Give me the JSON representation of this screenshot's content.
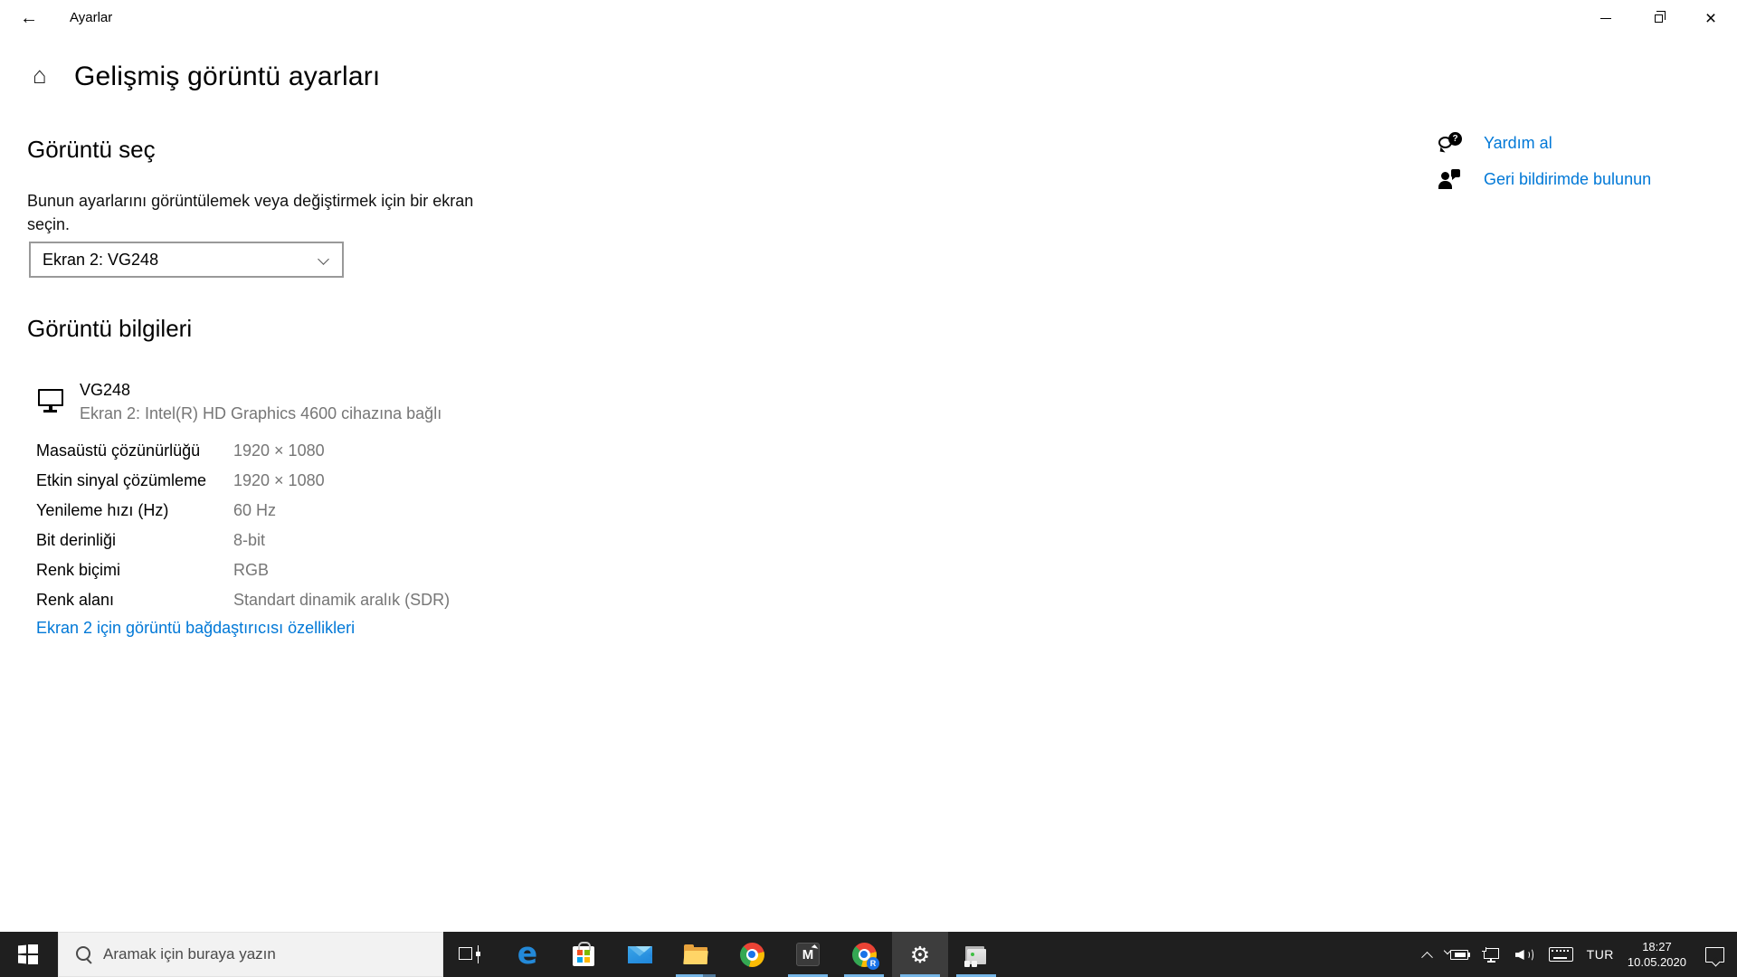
{
  "colors": {
    "accent_blue": "#0078d7",
    "link_blue": "#0078d7",
    "value_gray": "#767676",
    "taskbar_bg": "#1f1f1f",
    "running_underline": "#75b5e5"
  },
  "icons": {
    "back": "←",
    "home": "⌂",
    "close": "×",
    "gear": "⚙",
    "question": "?"
  },
  "titlebar": {
    "app_title": "Ayarlar"
  },
  "page": {
    "title": "Gelişmiş görüntü ayarları"
  },
  "display_select": {
    "heading": "Görüntü seç",
    "description": "Bunun ayarlarını görüntülemek veya değiştirmek için bir ekran seçin.",
    "selected_display": "Ekran 2: VG248"
  },
  "display_info": {
    "heading": "Görüntü bilgileri",
    "monitor_name": "VG248",
    "monitor_connection": "Ekran 2: Intel(R) HD Graphics 4600 cihazına bağlı",
    "properties": [
      {
        "label": "Masaüstü çözünürlüğü",
        "value": "1920 × 1080"
      },
      {
        "label": "Etkin sinyal çözümleme",
        "value": "1920 × 1080"
      },
      {
        "label": "Yenileme hızı (Hz)",
        "value": "60 Hz"
      },
      {
        "label": "Bit derinliği",
        "value": "8-bit"
      },
      {
        "label": "Renk biçimi",
        "value": "RGB"
      },
      {
        "label": "Renk alanı",
        "value": "Standart dinamik aralık (SDR)"
      }
    ],
    "adapter_link": "Ekran 2 için görüntü bağdaştırıcısı özellikleri"
  },
  "help_panel": {
    "get_help": "Yardım al",
    "feedback": "Geri bildirimde bulunun"
  },
  "taskbar": {
    "search_placeholder": "Aramak için buraya yazın",
    "m_app_label": "M",
    "chrome_profile_badge": "R",
    "tray": {
      "language": "TUR",
      "time": "18:27",
      "date": "10.05.2020"
    }
  }
}
